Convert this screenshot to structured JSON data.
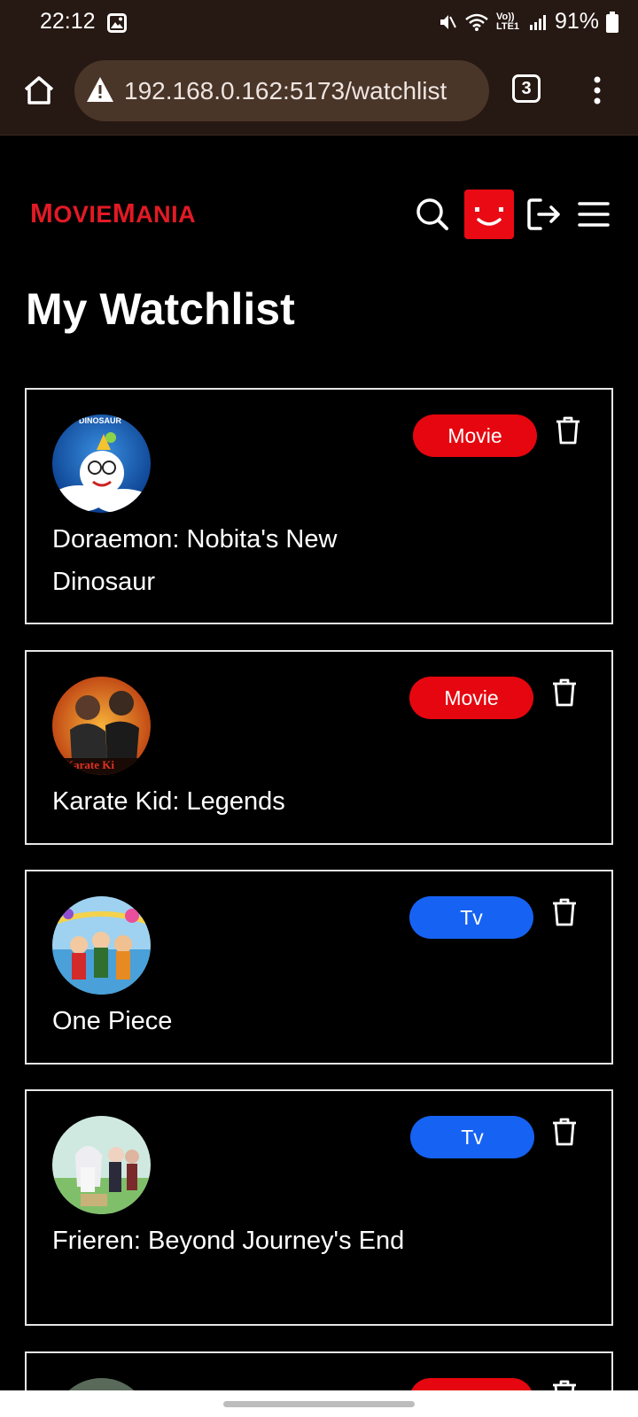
{
  "status_bar": {
    "time": "22:12",
    "signal_text": "Vo)) LTE1",
    "battery": "91%"
  },
  "browser": {
    "url": "192.168.0.162:5173/watchlist",
    "tab_count": "3"
  },
  "header": {
    "logo_text": "MovieMania",
    "logo_letters": {
      "m1": "M",
      "ovie": "OVIE",
      "m2": "M",
      "ania": "ANIA"
    }
  },
  "page": {
    "title": "My Watchlist"
  },
  "watchlist": [
    {
      "title": "Doraemon: Nobita's New Dinosaur",
      "type": "Movie",
      "thumb_text": "DINOSAUR"
    },
    {
      "title": "Karate Kid: Legends",
      "type": "Movie",
      "thumb_text": "Karate Ki"
    },
    {
      "title": "One Piece",
      "type": "Tv"
    },
    {
      "title": "Frieren: Beyond Journey's End",
      "type": "Tv"
    },
    {
      "title": "",
      "type": "Movie"
    }
  ],
  "colors": {
    "brand_red": "#e21a25",
    "movie_badge": "#e6060f",
    "tv_badge": "#1662f3",
    "browser_bar": "#261812"
  },
  "icons": [
    "home-icon",
    "warning-icon",
    "tabs-icon",
    "more-vert-icon",
    "search-icon",
    "avatar-icon",
    "logout-icon",
    "hamburger-icon",
    "trash-icon"
  ]
}
